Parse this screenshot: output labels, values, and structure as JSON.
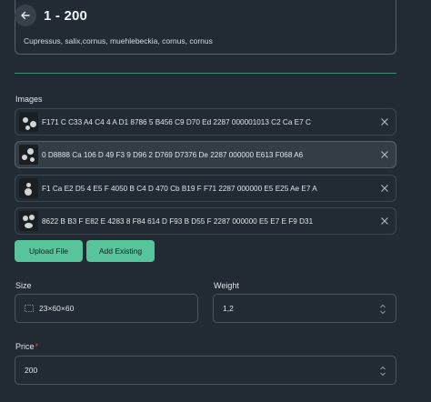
{
  "header": {
    "title": "1 - 200"
  },
  "top_field": {
    "value": "Cupressus, salix,cornus, muehlebeckia, cornus, cornus"
  },
  "images_section": {
    "label": "Images",
    "items": [
      {
        "name": "F171 C C33 A4 C4 4 A D1 8786 5 B456 C9 D70 Ed 2287 000001013 C2 Ca E7 C",
        "selected": false
      },
      {
        "name": "0 D8888 Ca 106 D 49 F3 9 D96 2 D769 D7376 De 2287 000000 E613 F068 A6",
        "selected": true
      },
      {
        "name": "F1 Ca E2 D5 4 E5 F 4050 B C4 D 470 Cb B19 F F71 2287 000000 E5 E25 Ae E7 A",
        "selected": false
      },
      {
        "name": "8622 B B3 F E82 E 4283 8 F84 614 D F93 B D55 F 2287 000000 E5 E7 E F9 D31",
        "selected": false
      }
    ]
  },
  "actions": {
    "upload_label": "Upload File",
    "add_existing_label": "Add Existing"
  },
  "size": {
    "label": "Size",
    "value": "23×60×60",
    "icon": "dimensions-icon"
  },
  "weight": {
    "label": "Weight",
    "value": "1,2"
  },
  "price": {
    "label": "Price",
    "required_mark": "*",
    "value": "200"
  },
  "colors": {
    "accent": "#58c49c",
    "background": "#222b33",
    "divider": "#3f8f78"
  }
}
